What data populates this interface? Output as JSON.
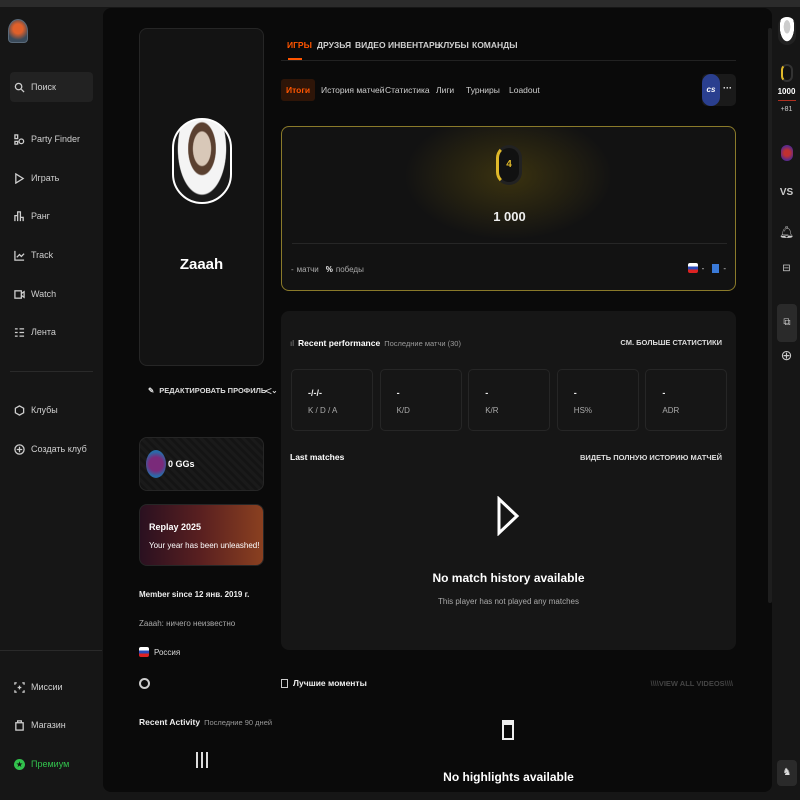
{
  "sidebar": {
    "search": "Поиск",
    "items": [
      {
        "label": "Party Finder",
        "icon": "party-finder-icon"
      },
      {
        "label": "Играть",
        "icon": "play-icon"
      },
      {
        "label": "Ранг",
        "icon": "rank-icon"
      },
      {
        "label": "Track",
        "icon": "track-icon"
      },
      {
        "label": "Watch",
        "icon": "watch-icon"
      },
      {
        "label": "Лента",
        "icon": "feed-icon"
      }
    ],
    "clubs": "Клубы",
    "create_club": "Создать клуб",
    "missions": "Миссии",
    "shop": "Магазин",
    "premium": "Премиум"
  },
  "colors": {
    "accent": "#ff5500",
    "premium": "#32c24d",
    "gold": "#e0b92a",
    "cs_badge": "#2a3f8f"
  },
  "profile": {
    "name": "Zaaah",
    "edit": "РЕДАКТИРОВАТЬ ПРОФИЛЬ",
    "ggs": "0 GGs",
    "replay_title": "Replay 2025",
    "replay_sub": "Your year has been unleashed!",
    "member_since": "Member since 12 янв. 2019 г.",
    "bio": "Zaaah: ничего неизвестно",
    "country": "Россия",
    "recent_activity": "Recent Activity",
    "recent_activity_sub": "Последние 90 дней"
  },
  "tabs": [
    "ИГРЫ",
    "ДРУЗЬЯ",
    "ВИДЕО",
    "ИНВЕНТАРЬ",
    "КЛУБЫ",
    "КОМАНДЫ"
  ],
  "subtabs": [
    "Итоги",
    "История матчей",
    "Статистика",
    "Лиги",
    "Турниры",
    "Loadout"
  ],
  "game_badge": "cs",
  "rank": {
    "level": "4",
    "elo": "1 000",
    "matches_value": "-",
    "matches_label": "матчи",
    "wins_value": "%",
    "wins_label": "победы",
    "region_value": "-",
    "country_value": "-"
  },
  "performance": {
    "title": "Recent performance",
    "subtitle": "Последние матчи (30)",
    "more": "СМ. БОЛЬШЕ СТАТИСТИКИ",
    "stats": [
      {
        "value": "-/-/-",
        "label": "K / D / A"
      },
      {
        "value": "-",
        "label": "K/D"
      },
      {
        "value": "-",
        "label": "K/R"
      },
      {
        "value": "-",
        "label": "HS%"
      },
      {
        "value": "-",
        "label": "ADR"
      }
    ],
    "last_matches": "Last matches",
    "full_history": "ВИДЕТЬ ПОЛНУЮ ИСТОРИЮ МАТЧЕЙ",
    "empty_title": "No match history available",
    "empty_sub": "This player has not played any matches"
  },
  "highlights": {
    "title": "Лучшие моменты",
    "view_all": "\\\\\\\\VIEW ALL VIDEOS\\\\\\\\",
    "empty": "No highlights available"
  },
  "rail": {
    "elo": "1000",
    "elo_delta": "+81",
    "vs": "VS"
  }
}
